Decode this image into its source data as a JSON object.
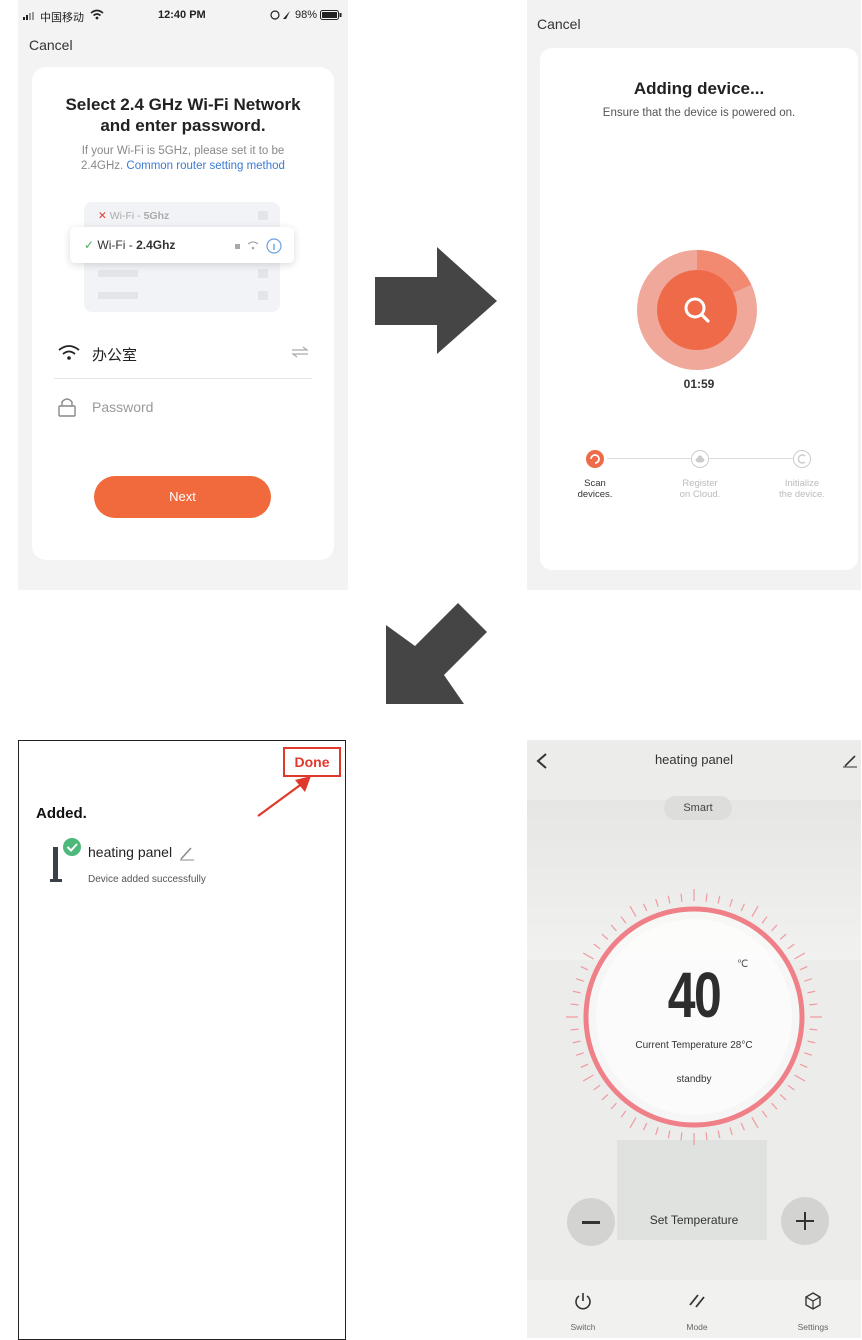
{
  "panel1": {
    "status": {
      "carrier": "中国移动",
      "time": "12:40 PM",
      "battery": "98%"
    },
    "cancel": "Cancel",
    "title_line1": "Select 2.4 GHz Wi-Fi Network",
    "title_line2": "and enter password.",
    "hint_line1": "If your Wi-Fi is 5GHz, please set it to be",
    "hint_line2_prefix": "2.4GHz.",
    "hint_link": "Common router setting method",
    "wifi_5g_prefix": "Wi-Fi - ",
    "wifi_5g_bold": "5Ghz",
    "wifi_24_prefix": "Wi-Fi - ",
    "wifi_24_bold": "2.4Ghz",
    "ssid_value": "办公室",
    "password_placeholder": "Password",
    "next_label": "Next",
    "accent": "#f06a3d"
  },
  "panel2": {
    "cancel": "Cancel",
    "title": "Adding device...",
    "hint": "Ensure that the device is powered on.",
    "timer": "01:59",
    "progress": 0.18,
    "steps": [
      {
        "line1": "Scan",
        "line2": "devices."
      },
      {
        "line1": "Register",
        "line2": "on Cloud."
      },
      {
        "line1": "Initialize",
        "line2": "the device."
      }
    ]
  },
  "panel3": {
    "done_label": "Done",
    "title": "Added.",
    "device_name": "heating panel",
    "device_status": "Device added successfully",
    "highlight_color": "#e0382a"
  },
  "panel4": {
    "title": "heating panel",
    "mode_pill": "Smart",
    "set_temp_value": "40",
    "unit": "℃",
    "current_temp": "Current Temperature 28°C",
    "status": "standby",
    "set_label": "Set Temperature",
    "nav": [
      {
        "label": "Switch",
        "icon": "power-icon"
      },
      {
        "label": "Mode",
        "icon": "mode-icon"
      },
      {
        "label": "Settings",
        "icon": "settings-icon"
      }
    ],
    "ring_color": "#e8707a"
  },
  "arrows": {
    "color": "#454545"
  }
}
